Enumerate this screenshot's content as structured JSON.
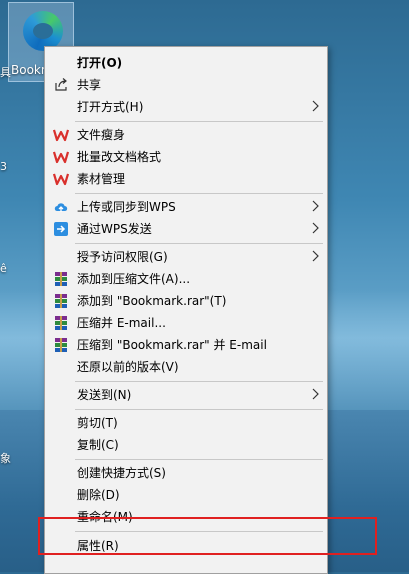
{
  "desktop": {
    "icon_label": "Bookn",
    "left_chars": [
      "具",
      "3",
      "ê",
      "象"
    ]
  },
  "menu": {
    "items": [
      {
        "label": "打开(O)",
        "bold": true
      },
      {
        "label": "共享"
      },
      {
        "label": "打开方式(H)"
      },
      {
        "label": "文件瘦身"
      },
      {
        "label": "批量改文档格式"
      },
      {
        "label": "素材管理"
      },
      {
        "label": "上传或同步到WPS"
      },
      {
        "label": "通过WPS发送"
      },
      {
        "label": "授予访问权限(G)"
      },
      {
        "label": "添加到压缩文件(A)..."
      },
      {
        "label": "添加到 \"Bookmark.rar\"(T)"
      },
      {
        "label": "压缩并 E-mail..."
      },
      {
        "label": "压缩到 \"Bookmark.rar\" 并 E-mail"
      },
      {
        "label": "还原以前的版本(V)"
      },
      {
        "label": "发送到(N)"
      },
      {
        "label": "剪切(T)"
      },
      {
        "label": "复制(C)"
      },
      {
        "label": "创建快捷方式(S)"
      },
      {
        "label": "删除(D)"
      },
      {
        "label": "重命名(M)"
      },
      {
        "label": "属性(R)"
      }
    ]
  },
  "colors": {
    "highlight_border": "#e02020",
    "wps_red": "#d9302c",
    "cloud_blue": "#2d8ee0"
  }
}
